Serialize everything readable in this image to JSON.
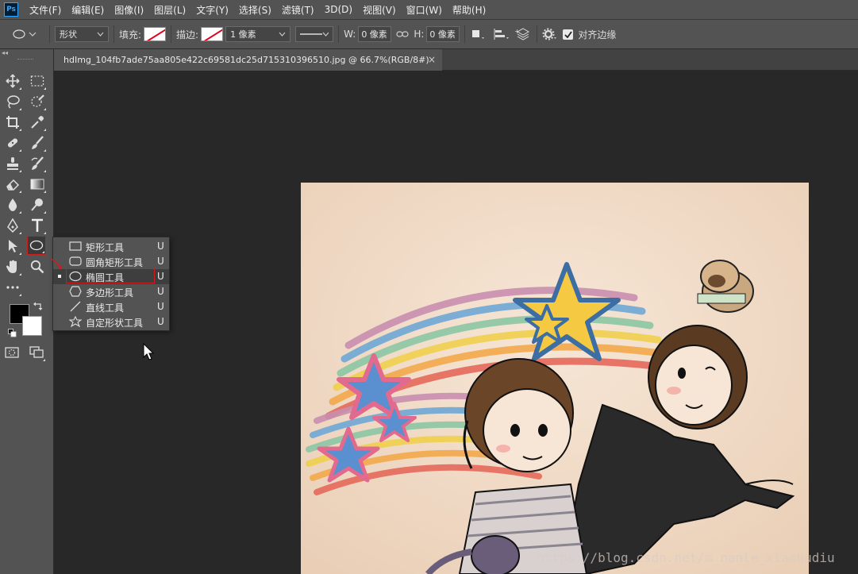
{
  "menubar": {
    "logo": "Ps",
    "items": [
      "文件(F)",
      "编辑(E)",
      "图像(I)",
      "图层(L)",
      "文字(Y)",
      "选择(S)",
      "滤镜(T)",
      "3D(D)",
      "视图(V)",
      "窗口(W)",
      "帮助(H)"
    ]
  },
  "options": {
    "mode": "形状",
    "fill_label": "填充:",
    "stroke_label": "描边:",
    "stroke_width": "1 像素",
    "w_label": "W:",
    "w_value": "0 像素",
    "h_label": "H:",
    "h_value": "0 像素",
    "align_edges": "对齐边缘",
    "align_edges_checked": true
  },
  "document": {
    "tab_title": "hdImg_104fb7ade75aa805e422c69581dc25d715310396510.jpg @ 66.7%(RGB/8#)",
    "close_glyph": "×"
  },
  "flyout": {
    "items": [
      {
        "label": "矩形工具",
        "key": "U",
        "icon": "rectangle-icon"
      },
      {
        "label": "圆角矩形工具",
        "key": "U",
        "icon": "rounded-rectangle-icon"
      },
      {
        "label": "椭圆工具",
        "key": "U",
        "icon": "ellipse-icon",
        "selected": true
      },
      {
        "label": "多边形工具",
        "key": "U",
        "icon": "polygon-icon"
      },
      {
        "label": "直线工具",
        "key": "U",
        "icon": "line-icon"
      },
      {
        "label": "自定形状工具",
        "key": "U",
        "icon": "custom-shape-icon"
      }
    ]
  },
  "colors": {
    "foreground": "#000000",
    "background": "#ffffff",
    "accent": "#c91f1f"
  },
  "watermark": "https://blog.csdn.net/m_nanle_xiaobudiu"
}
